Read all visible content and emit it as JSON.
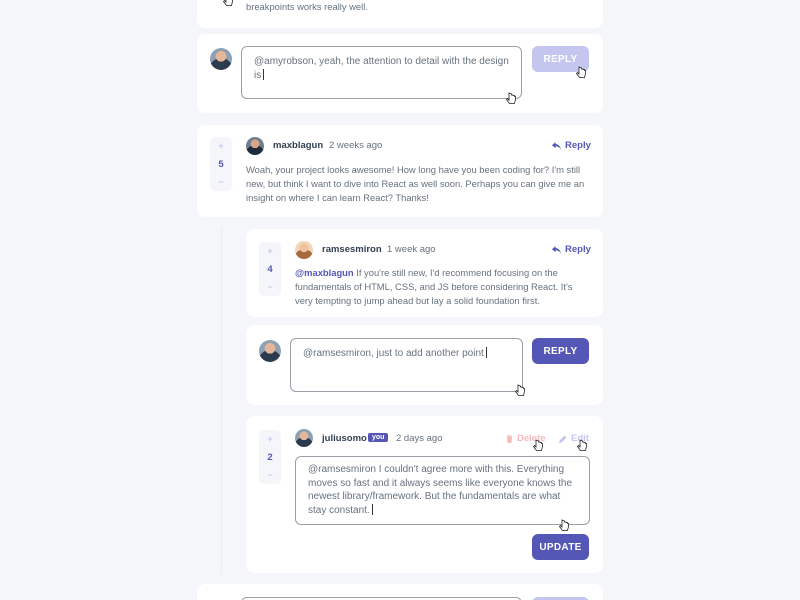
{
  "top_comment_tail": {
    "text": "breakpoints works really well."
  },
  "reply_box_1": {
    "value": "@amyrobson, yeah, the attention to detail with the design is",
    "button_label": "REPLY"
  },
  "comment_maxblagun": {
    "username": "maxblagun",
    "time": "2 weeks ago",
    "score": "5",
    "reply_label": "Reply",
    "text": "Woah, your project looks awesome! How long have you been coding for? I'm still new, but think I want to dive into React as well soon. Perhaps you can give me an insight on where I can learn React? Thanks!"
  },
  "reply_ramsesmiron": {
    "username": "ramsesmiron",
    "time": "1 week ago",
    "score": "4",
    "reply_label": "Reply",
    "mention": "@maxblagun",
    "text": " If you're still new, I'd recommend focusing on the fundamentals of HTML, CSS, and JS before considering React. It's very tempting to jump ahead but lay a solid foundation first."
  },
  "reply_box_2": {
    "value": "@ramsesmiron, just to add another point",
    "button_label": "REPLY"
  },
  "reply_juliusomo": {
    "username": "juliusomo",
    "badge": "you",
    "time": "2 days ago",
    "score": "2",
    "delete_label": "Delete",
    "edit_label": "Edit",
    "edit_value": "@ramsesmiron I couldn't agree more with this. Everything moves so fast and it always seems like everyone knows the newest library/framework. But the fundamentals are what stay constant.",
    "update_label": "UPDATE"
  },
  "vote_symbols": {
    "plus": "+",
    "minus": "−"
  },
  "colors": {
    "primary": "#5457b6",
    "primary_faded": "#c5c6ef",
    "danger_faded": "#f6b9bb",
    "background": "#f5f6fa"
  }
}
